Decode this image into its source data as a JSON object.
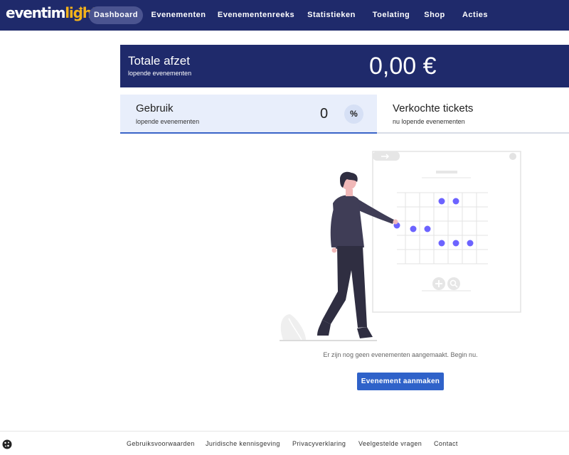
{
  "brand": {
    "logo_white": "eventim",
    "logo_gold": "light",
    "star": "✦"
  },
  "nav": {
    "items": [
      {
        "label": "Dashboard",
        "active": true
      },
      {
        "label": "Evenementen"
      },
      {
        "label": "Evenementenreeks"
      },
      {
        "label": "Statistieken"
      },
      {
        "label": "Toelating"
      },
      {
        "label": "Shop"
      },
      {
        "label": "Acties"
      }
    ]
  },
  "revenue": {
    "title": "Totale afzet",
    "subtitle": "lopende evenementen",
    "amount": "0,00 €"
  },
  "usage": {
    "title": "Gebruik",
    "subtitle": "lopende evenementen",
    "count": "0",
    "toggle_icon": "percent-icon",
    "toggle_symbol": "%"
  },
  "tickets": {
    "title": "Verkochte tickets",
    "subtitle": "nu lopende evenementen"
  },
  "empty_state": {
    "message": "Er zijn nog geen evenementen aangemaakt. Begin nu.",
    "button_label": "Evenement aanmaken"
  },
  "footer": {
    "links": [
      "Gebruiksvoorwaarden",
      "Juridische kennisgeving",
      "Privacyverklaring",
      "Veelgestelde vragen",
      "Contact"
    ],
    "cookie_icon": "cookie-icon"
  },
  "colors": {
    "navy": "#1f2a6b",
    "gold": "#f3b21b",
    "accent": "#2f62c9",
    "dot": "#6c63ff",
    "usage_bg": "#e8eefb"
  }
}
